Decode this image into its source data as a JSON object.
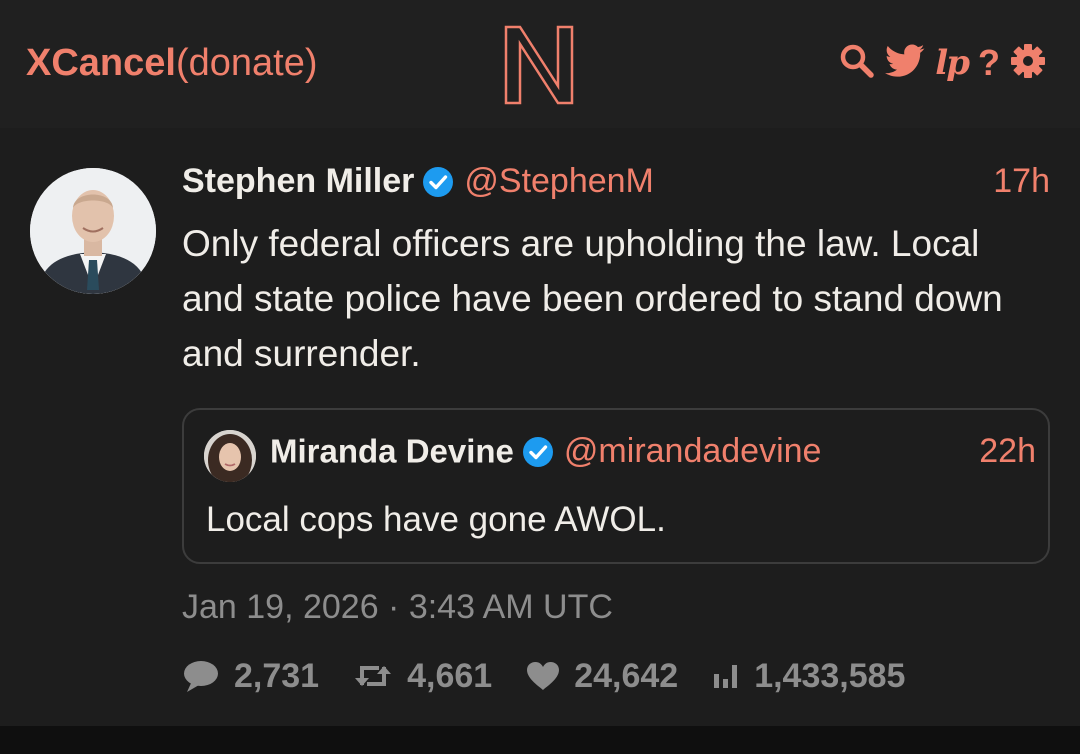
{
  "navbar": {
    "site_name": "XCancel",
    "donate_label": "(donate)",
    "logo_letter": "N",
    "icons": [
      "search-icon",
      "twitter-bird-icon",
      "lp-icon",
      "help-icon",
      "gear-icon"
    ],
    "lp_label": "lp",
    "help_label": "?"
  },
  "tweet": {
    "author_name": "Stephen Miller",
    "author_handle": "@StephenM",
    "verified": true,
    "time": "17h",
    "text": "Only federal officers are upholding the law. Local and state police have been ordered to stand down and surrender.",
    "quote": {
      "author_name": "Miranda Devine",
      "author_handle": "@mirandadevine",
      "verified": true,
      "time": "22h",
      "text": "Local cops have gone AWOL."
    },
    "date": "Jan 19, 2026 · 3:43 AM UTC",
    "stats": {
      "replies": "2,731",
      "retweets": "4,661",
      "likes": "24,642",
      "views": "1,433,585"
    }
  },
  "colors": {
    "accent": "#f0806c",
    "navbar_bg": "#202020",
    "tweet_bg": "#1d1d1d",
    "page_bg": "#0f0f0f",
    "verified_blue": "#1d9bf0",
    "muted_text": "#8d8d8d"
  }
}
